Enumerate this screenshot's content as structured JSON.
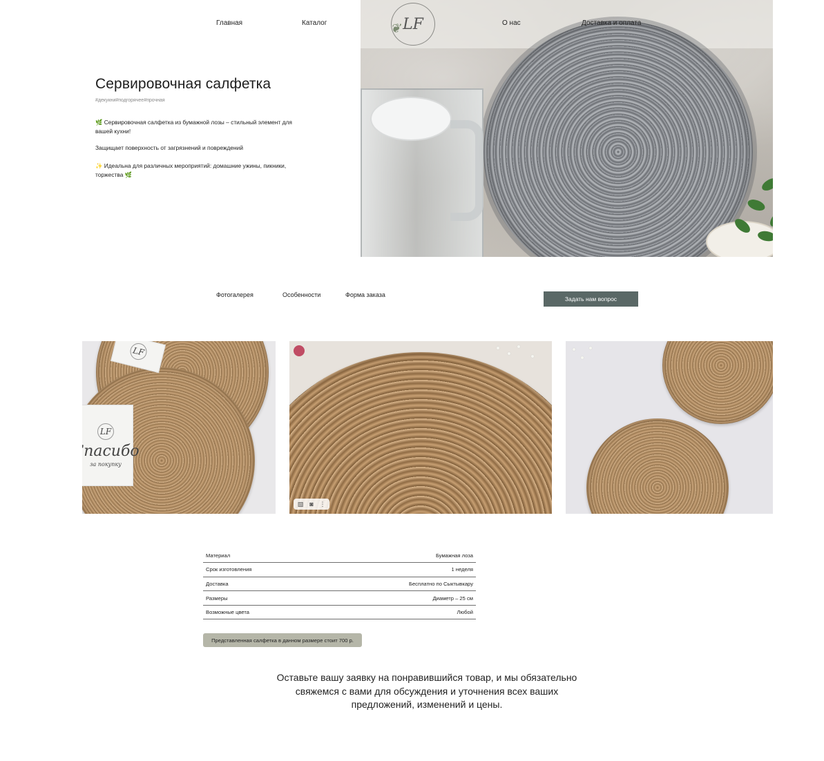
{
  "nav": {
    "home": "Главная",
    "catalog": "Каталог",
    "about": "О нас",
    "delivery": "Доставка и оплата",
    "logo_text": "LF"
  },
  "hero": {
    "title": "Сервировочная салфетка",
    "tags": "#декукни#подгорячее#прочная",
    "p1": "🌿 Сервировочная салфетка из бумажной лозы – стильный элемент для вашей кухни!",
    "p2": " Защищает поверхность от загрязнений и повреждений",
    "p3": " ✨ Идеальна для различных мероприятий: домашние ужины, пикники, торжества 🌿"
  },
  "subnav": {
    "gallery": "Фотогалерея",
    "features": "Особенности",
    "order_form": "Форма заказа",
    "ask_button": "Задать нам вопрос"
  },
  "gallery": {
    "card_title": "Спасибо",
    "card_subtitle": "за покупку",
    "card_logo": "LF",
    "overlay_icons": [
      "image-icon",
      "camera-icon",
      "more-icon"
    ]
  },
  "specs": [
    {
      "label": "Материал",
      "value": "Бумажная лоза"
    },
    {
      "label": "Срок изготовления",
      "value": "1 неделя"
    },
    {
      "label": "Доставка",
      "value": "Бесплатно по Сыктывкару"
    },
    {
      "label": "Размеры",
      "value": "Диаметр – 25 см"
    },
    {
      "label": "Возможные цвета",
      "value": "Любой"
    }
  ],
  "price_note": "Представленная салфетка в данном размере стоит 700 р.",
  "cta": "Оставьте вашу заявку на понравившийся товар, и мы обязательно свяжемся с вами для обсуждения и уточнения всех ваших предложений, изменений и цены.",
  "colors": {
    "button_bg": "#5a6866",
    "price_pill_bg": "#b5b6a8",
    "table_rule": "#6e6e6e"
  }
}
